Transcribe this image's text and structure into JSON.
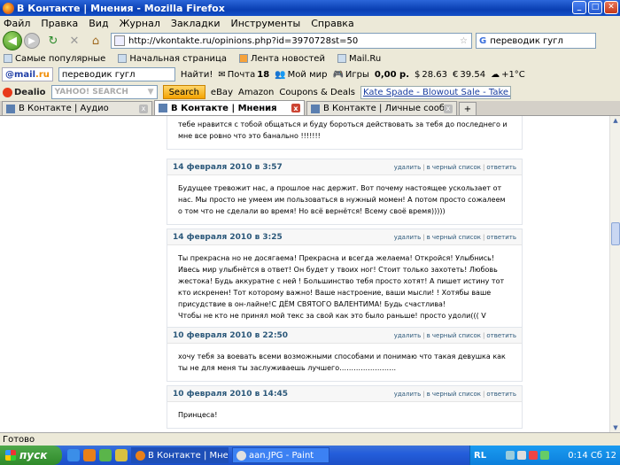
{
  "window": {
    "title": "В Контакте | Мнения - Mozilla Firefox",
    "minimize": "_",
    "maximize": "□",
    "close": "✕"
  },
  "menu": [
    "Файл",
    "Правка",
    "Вид",
    "Журнал",
    "Закладки",
    "Инструменты",
    "Справка"
  ],
  "nav": {
    "url": "http://vkontakte.ru/opinions.php?id=3970728st=50",
    "search_value": "переводик гугл"
  },
  "bookmarks": [
    "Самые популярные",
    "Начальная страница",
    "Лента новостей",
    "Mail.Ru"
  ],
  "mailru": {
    "logo_pre": "@mail",
    "logo_post": ".ru",
    "search_value": "переводик гугл",
    "find": "Найти!",
    "mail": "Почта",
    "mail_count": "18",
    "myworld": "Мой мир",
    "games": "Игры",
    "money": "0,00 р.",
    "usd": "28.63",
    "eur": "39.54",
    "weather": "+1°C"
  },
  "dealio": {
    "logo": "Dealio",
    "yahoo_placeholder": "YAHOO! SEARCH",
    "search_btn": "Search",
    "ebay": "eBay",
    "amazon": "Amazon",
    "coupons": "Coupons & Deals",
    "promo": "Kate Spade - Blowout Sale - Take 75% off Clea"
  },
  "tabs": [
    {
      "label": "В Контакте | Аудио",
      "active": false
    },
    {
      "label": "В Контакте | Мнения",
      "active": true
    },
    {
      "label": "В Контакте | Личные сообщения",
      "active": false
    }
  ],
  "actions": {
    "delete": "удалить",
    "blacklist": "в черный список",
    "reply": "ответить"
  },
  "posts": [
    {
      "date": "",
      "text": "тебе нравится с тобой общаться и буду бороться действовать за тебя до последнего и мне все ровно что это банально !!!!!!!",
      "show_head": false
    },
    {
      "date": "14 февраля 2010 в 3:57",
      "text": "Будущее тревожит нас, а прошлое нас держит. Вот почему настоящее ускользает от нас. Мы просто не умеем им пользоваться в нужный момен! А потом просто сожалеем о том что не сделали во время! Но всё вернётся! Всему своё время)))))",
      "show_head": true
    },
    {
      "date": "14 февраля 2010 в 3:25",
      "text": "Ты прекрасна но не досягаема! Прекрасна и всегда желаема! Откройся! Улыбнись! Ивесь мир улыбнётся в ответ! Он будет у твоих ног! Стоит только захотеть! Любовь жестока! Будь аккуратне с ней ! Большинство тебя просто хотят! А пишет истину тот кто искренен! Тот которому важно! Ваше настроение, ваши мысли! ! Хотябы ваше присудствие в он-лайне!С ДЁМ СВЯТОГО ВАЛЕНТИМА! Будь счастлива!\nЧтобы не кто не принял мой текс за свой как это было раньше! просто удоли((( V",
      "show_head": true
    },
    {
      "date": "10 февраля 2010 в 22:50",
      "text": "хочу тебя за воевать всеми возможными способами и понимаю что такая девушка как ты не для меня ты заслуживаешь лучшего……………………",
      "show_head": true
    },
    {
      "date": "10 февраля 2010 в 14:45",
      "text": "Принцеса!",
      "show_head": true
    }
  ],
  "status": "Готово",
  "taskbar": {
    "start": "пуск",
    "task1": "В Контакте | Мнени...",
    "task2": "aan.JPG - Paint",
    "lang": "RL",
    "clock": "0:14 Сб 12"
  }
}
